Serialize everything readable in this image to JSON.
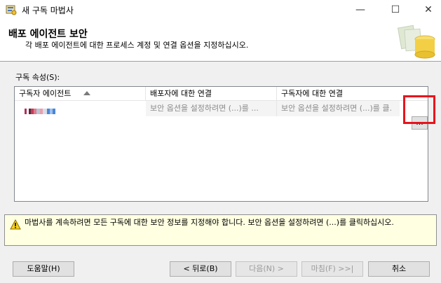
{
  "window": {
    "title": "새 구독 마법사",
    "minimize_glyph": "—",
    "maximize_glyph": "☐",
    "close_glyph": "✕"
  },
  "header": {
    "title": "배포 에이전트 보안",
    "subtitle": "각 배포 에이전트에 대한 프로세스 계정 및 연결 옵션을 지정하십시오."
  },
  "grid": {
    "label": "구독 속성(S):",
    "columns": [
      "구독자 에이전트",
      "배포자에 대한 연결",
      "구독자에 대한 연결"
    ],
    "rows": [
      {
        "agent": "",
        "distributor_connection": "보안 옵션을 설정하려면 (...)를 ...",
        "subscriber_connection": "보안 옵션을 설정하려면 (...)를 클.",
        "browse_label": "..."
      }
    ]
  },
  "warning": {
    "icon": "warning-icon",
    "text": "마법사를 계속하려면 모든 구독에 대한 보안 정보를 지정해야 합니다. 보안 옵션을 설정하려면 (...)를 클릭하십시오."
  },
  "buttons": {
    "help": "도움말(H)",
    "back": "< 뒤로(B)",
    "next": "다음(N) >",
    "finish": "마침(F) >>|",
    "cancel": "취소"
  },
  "colors": {
    "highlight": "#e8141c",
    "warning_bg": "#ffffe1"
  }
}
